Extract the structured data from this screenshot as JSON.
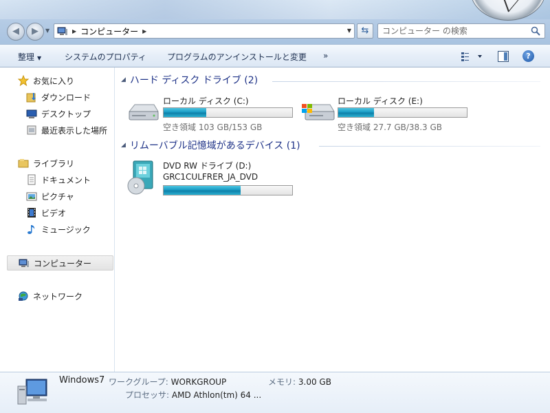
{
  "window": {
    "address": {
      "crumb": "コンピューター"
    },
    "search": {
      "placeholder": "コンピューター の検索"
    }
  },
  "toolbar": {
    "organize": "整理",
    "system_properties": "システムのプロパティ",
    "uninstall": "プログラムのアンインストールと変更",
    "more": "»"
  },
  "nav": {
    "favorites": "お気に入り",
    "downloads": "ダウンロード",
    "desktop": "デスクトップ",
    "recent": "最近表示した場所",
    "libraries": "ライブラリ",
    "documents": "ドキュメント",
    "pictures": "ピクチャ",
    "videos": "ビデオ",
    "music": "ミュージック",
    "computer": "コンピューター",
    "network": "ネットワーク"
  },
  "groups": {
    "hdd_header": "ハード ディスク ドライブ (2)",
    "removable_header": "リムーバブル記憶域があるデバイス (1)"
  },
  "drives": [
    {
      "name": "ローカル ディスク (C:)",
      "free": "空き領域 103 GB/153 GB",
      "used_fraction": 0.33
    },
    {
      "name": "ローカル ディスク (E:)",
      "free": "空き領域 27.7 GB/38.3 GB",
      "used_fraction": 0.28
    },
    {
      "name": "DVD RW ドライブ (D:)",
      "label": "GRC1CULFRER_JA_DVD",
      "used_fraction": 0.6
    }
  ],
  "details": {
    "computer_name": "Windows7",
    "workgroup_label": "ワークグループ:",
    "workgroup": "WORKGROUP",
    "memory_label": "メモリ:",
    "memory": "3.00 GB",
    "processor_label": "プロセッサ:",
    "processor": "AMD Athlon(tm) 64 ..."
  },
  "colors": {
    "header_text": "#1e3287",
    "bar_fill": "#1a9bc4"
  }
}
